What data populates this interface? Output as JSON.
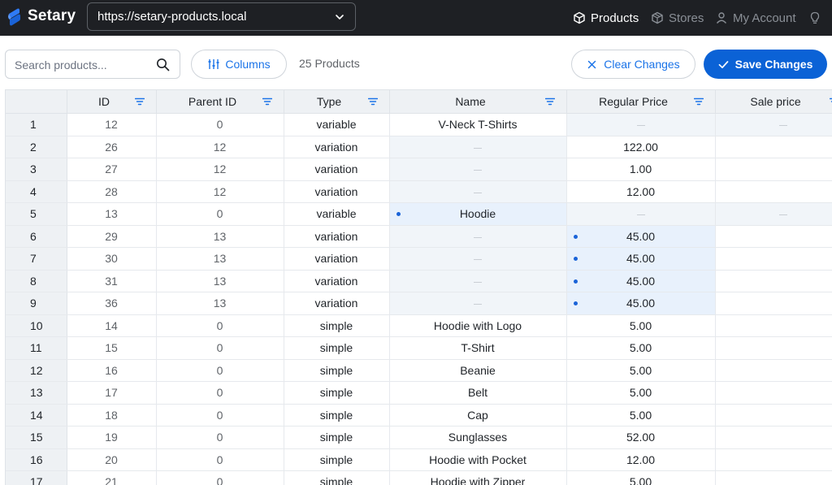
{
  "app": {
    "name": "Setary"
  },
  "store_selector": {
    "value": "https://setary-products.local"
  },
  "nav": {
    "products": "Products",
    "stores": "Stores",
    "account": "My Account"
  },
  "toolbar": {
    "search_placeholder": "Search products...",
    "columns_label": "Columns",
    "count": "25 Products",
    "clear_label": "Clear Changes",
    "save_label": "Save Changes"
  },
  "colors": {
    "topbar": "#1e2024",
    "accent": "#1a73e8",
    "primary_button": "#0b62d6",
    "edited_cell": "#e8f1fc",
    "empty_cell": "#f1f5f9"
  },
  "table": {
    "columns": [
      "ID",
      "Parent ID",
      "Type",
      "Name",
      "Regular Price",
      "Sale price"
    ],
    "rows": [
      {
        "n": "1",
        "id": "12",
        "parent": "0",
        "type": "variable",
        "name": "V-Neck T-Shirts",
        "price": "",
        "sale": "",
        "name_blank": false,
        "price_blank": true,
        "sale_blank": true,
        "name_edited": false,
        "price_edited": false
      },
      {
        "n": "2",
        "id": "26",
        "parent": "12",
        "type": "variation",
        "name": "",
        "price": "122.00",
        "sale": "",
        "name_blank": true,
        "price_blank": false,
        "sale_blank": false,
        "name_edited": false,
        "price_edited": false
      },
      {
        "n": "3",
        "id": "27",
        "parent": "12",
        "type": "variation",
        "name": "",
        "price": "1.00",
        "sale": "",
        "name_blank": true,
        "price_blank": false,
        "sale_blank": false,
        "name_edited": false,
        "price_edited": false
      },
      {
        "n": "4",
        "id": "28",
        "parent": "12",
        "type": "variation",
        "name": "",
        "price": "12.00",
        "sale": "",
        "name_blank": true,
        "price_blank": false,
        "sale_blank": false,
        "name_edited": false,
        "price_edited": false
      },
      {
        "n": "5",
        "id": "13",
        "parent": "0",
        "type": "variable",
        "name": "Hoodie",
        "price": "",
        "sale": "",
        "name_blank": false,
        "price_blank": true,
        "sale_blank": true,
        "name_edited": true,
        "price_edited": false
      },
      {
        "n": "6",
        "id": "29",
        "parent": "13",
        "type": "variation",
        "name": "",
        "price": "45.00",
        "sale": "",
        "name_blank": true,
        "price_blank": false,
        "sale_blank": false,
        "name_edited": false,
        "price_edited": true
      },
      {
        "n": "7",
        "id": "30",
        "parent": "13",
        "type": "variation",
        "name": "",
        "price": "45.00",
        "sale": "",
        "name_blank": true,
        "price_blank": false,
        "sale_blank": false,
        "name_edited": false,
        "price_edited": true
      },
      {
        "n": "8",
        "id": "31",
        "parent": "13",
        "type": "variation",
        "name": "",
        "price": "45.00",
        "sale": "",
        "name_blank": true,
        "price_blank": false,
        "sale_blank": false,
        "name_edited": false,
        "price_edited": true
      },
      {
        "n": "9",
        "id": "36",
        "parent": "13",
        "type": "variation",
        "name": "",
        "price": "45.00",
        "sale": "",
        "name_blank": true,
        "price_blank": false,
        "sale_blank": false,
        "name_edited": false,
        "price_edited": true
      },
      {
        "n": "10",
        "id": "14",
        "parent": "0",
        "type": "simple",
        "name": "Hoodie with Logo",
        "price": "5.00",
        "sale": "",
        "name_blank": false,
        "price_blank": false,
        "sale_blank": false,
        "name_edited": false,
        "price_edited": false
      },
      {
        "n": "11",
        "id": "15",
        "parent": "0",
        "type": "simple",
        "name": "T-Shirt",
        "price": "5.00",
        "sale": "",
        "name_blank": false,
        "price_blank": false,
        "sale_blank": false,
        "name_edited": false,
        "price_edited": false
      },
      {
        "n": "12",
        "id": "16",
        "parent": "0",
        "type": "simple",
        "name": "Beanie",
        "price": "5.00",
        "sale": "",
        "name_blank": false,
        "price_blank": false,
        "sale_blank": false,
        "name_edited": false,
        "price_edited": false
      },
      {
        "n": "13",
        "id": "17",
        "parent": "0",
        "type": "simple",
        "name": "Belt",
        "price": "5.00",
        "sale": "",
        "name_blank": false,
        "price_blank": false,
        "sale_blank": false,
        "name_edited": false,
        "price_edited": false
      },
      {
        "n": "14",
        "id": "18",
        "parent": "0",
        "type": "simple",
        "name": "Cap",
        "price": "5.00",
        "sale": "",
        "name_blank": false,
        "price_blank": false,
        "sale_blank": false,
        "name_edited": false,
        "price_edited": false
      },
      {
        "n": "15",
        "id": "19",
        "parent": "0",
        "type": "simple",
        "name": "Sunglasses",
        "price": "52.00",
        "sale": "",
        "name_blank": false,
        "price_blank": false,
        "sale_blank": false,
        "name_edited": false,
        "price_edited": false
      },
      {
        "n": "16",
        "id": "20",
        "parent": "0",
        "type": "simple",
        "name": "Hoodie with Pocket",
        "price": "12.00",
        "sale": "",
        "name_blank": false,
        "price_blank": false,
        "sale_blank": false,
        "name_edited": false,
        "price_edited": false
      },
      {
        "n": "17",
        "id": "21",
        "parent": "0",
        "type": "simple",
        "name": "Hoodie with Zipper",
        "price": "5.00",
        "sale": "",
        "name_blank": false,
        "price_blank": false,
        "sale_blank": false,
        "name_edited": false,
        "price_edited": false
      }
    ]
  }
}
